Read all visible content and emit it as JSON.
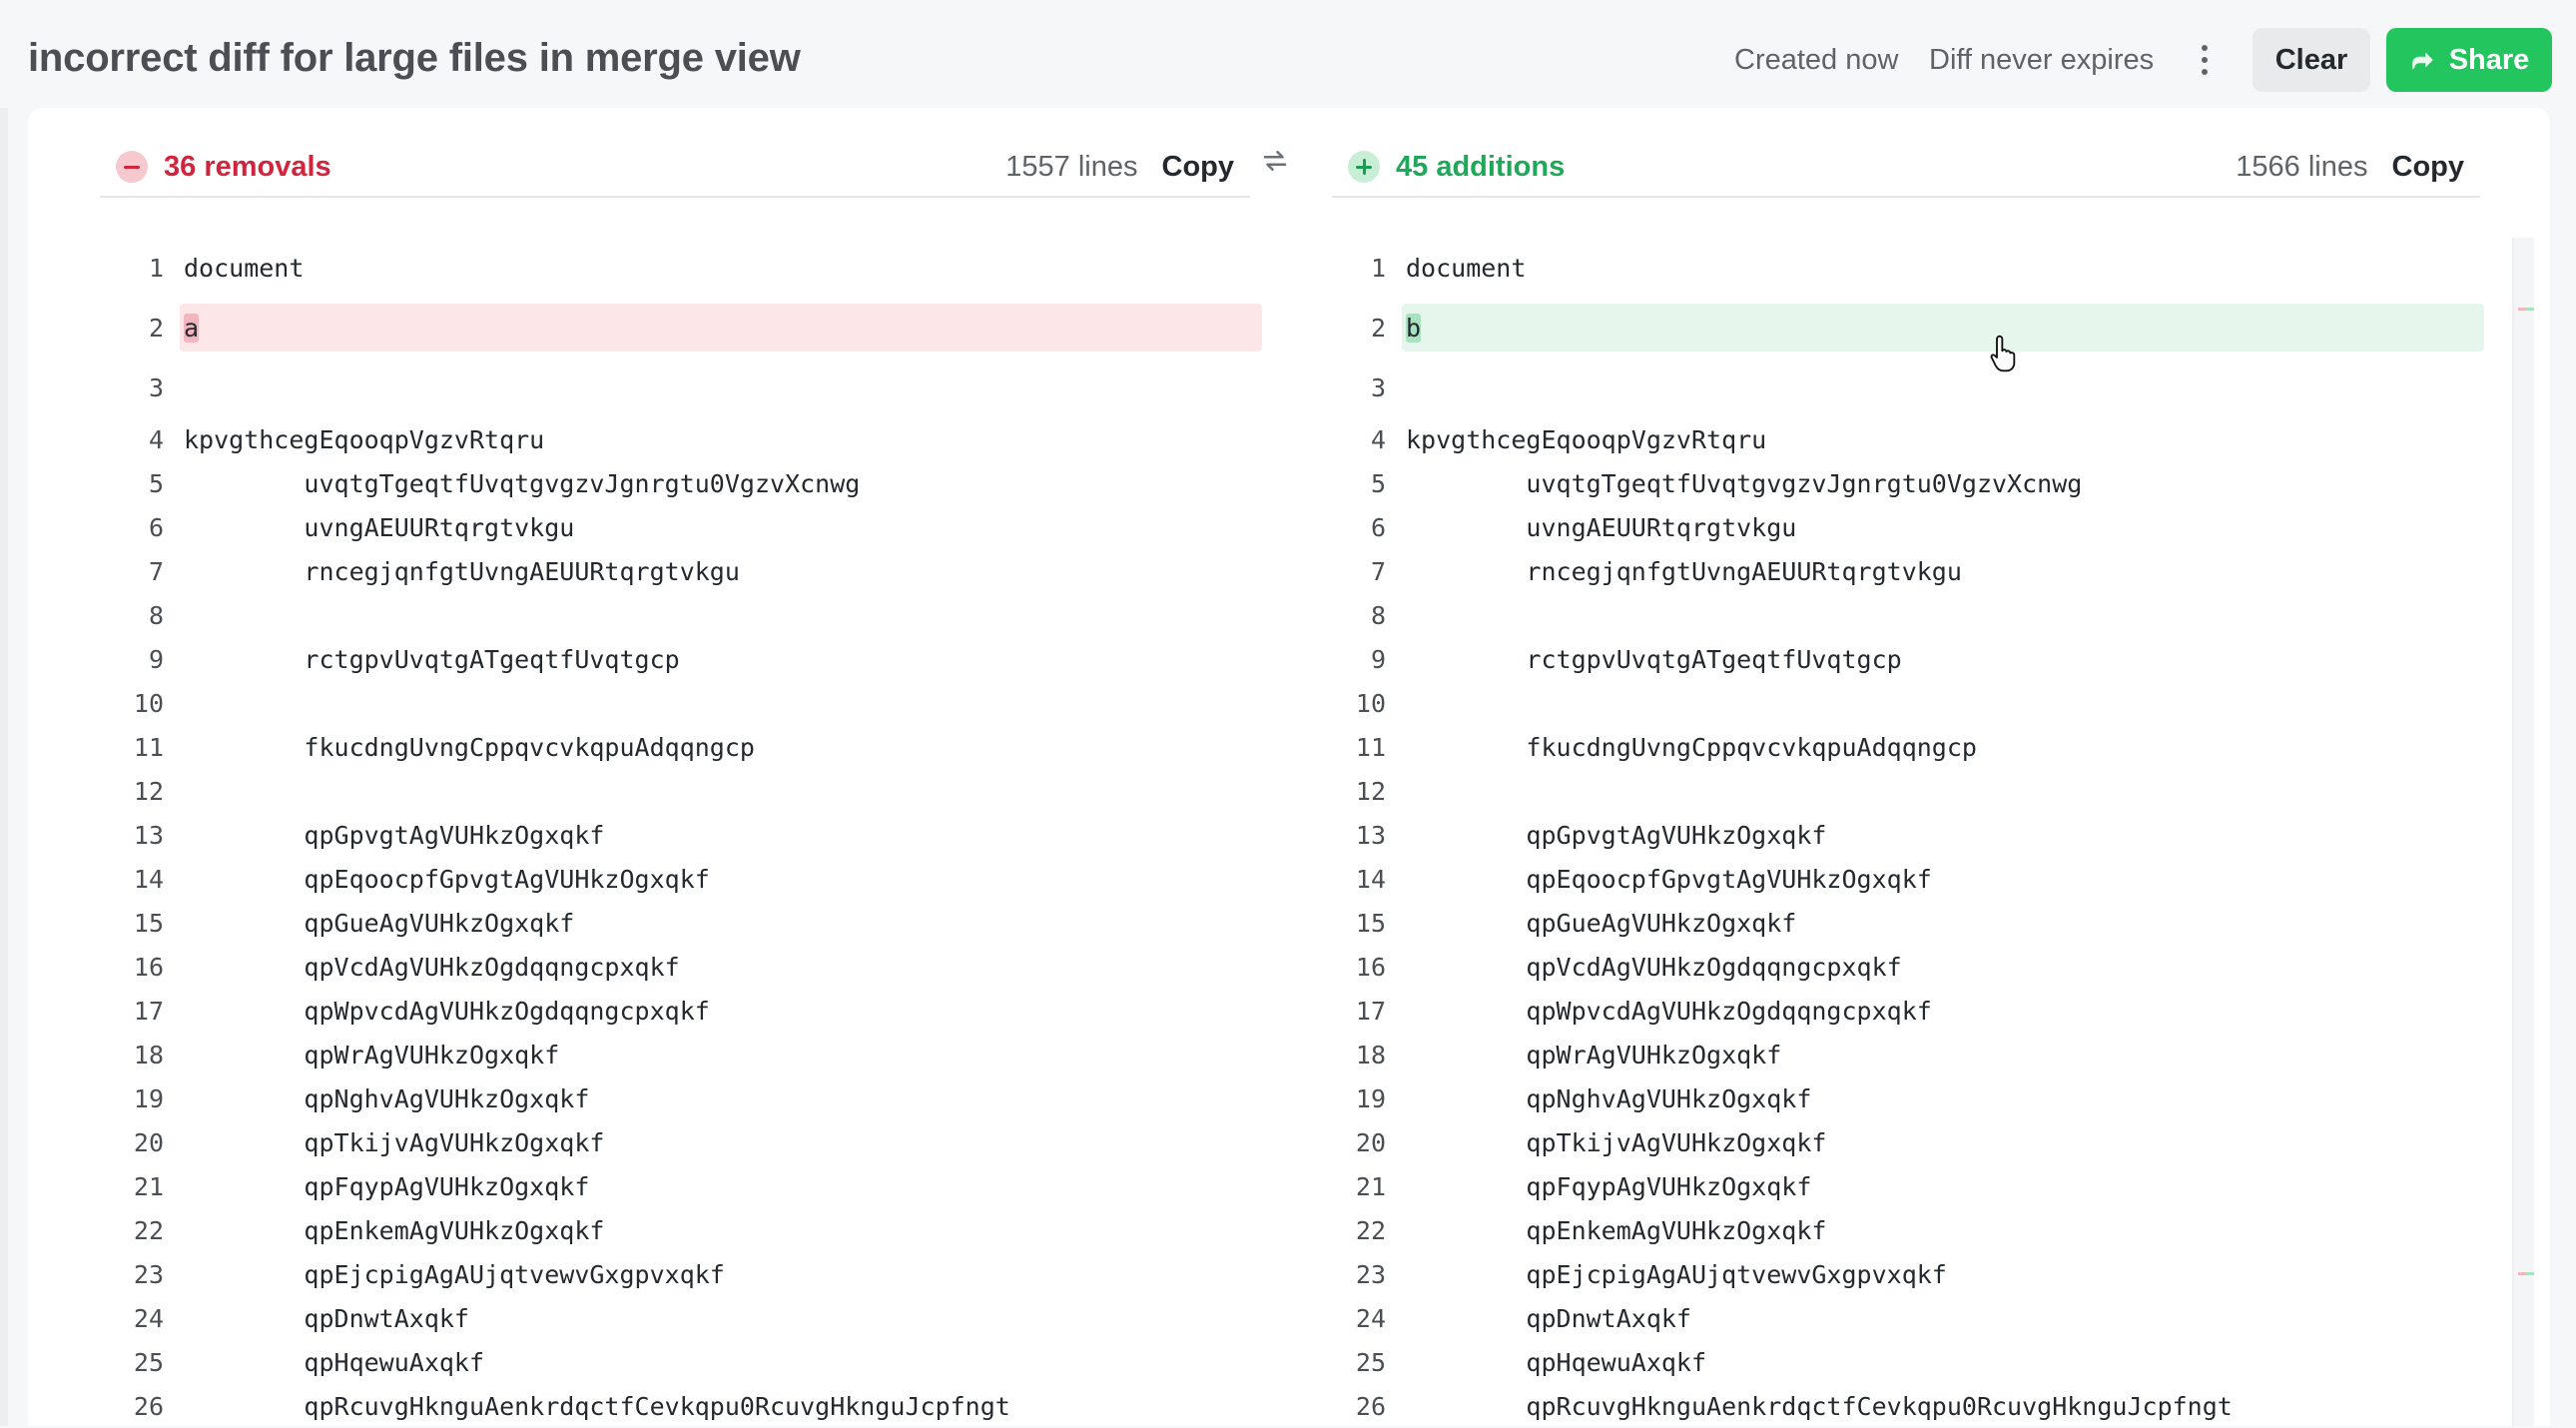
{
  "header": {
    "title": "incorrect diff for large files in merge view",
    "created": "Created now",
    "expires": "Diff never expires",
    "clear_label": "Clear",
    "share_label": "Share"
  },
  "left": {
    "summary": "36 removals",
    "lines": "1557 lines",
    "copy_label": "Copy"
  },
  "right": {
    "summary": "45 additions",
    "lines": "1566 lines",
    "copy_label": "Copy"
  },
  "colors": {
    "removal": "#d1243d",
    "addition": "#1fa85a",
    "share": "#22c55e"
  },
  "rows": [
    {
      "n": "1",
      "code": "document"
    },
    {
      "n": "2",
      "code": "",
      "changed": true,
      "left_char": "a",
      "right_char": "b"
    },
    {
      "n": "3",
      "code": ""
    },
    {
      "n": "4",
      "code": "kpvgthcegEqooqpVgzvRtqru"
    },
    {
      "n": "5",
      "code": "        uvqtgTgeqtfUvqtgvgzvJgnrgtu0VgzvXcnwg"
    },
    {
      "n": "6",
      "code": "        uvngAEUURtqrgtvkgu"
    },
    {
      "n": "7",
      "code": "        rncegjqnfgtUvngAEUURtqrgtvkgu"
    },
    {
      "n": "8",
      "code": ""
    },
    {
      "n": "9",
      "code": "        rctgpvUvqtgATgeqtfUvqtgcp"
    },
    {
      "n": "10",
      "code": ""
    },
    {
      "n": "11",
      "code": "        fkucdngUvngCppqvcvkqpuAdqqngcp"
    },
    {
      "n": "12",
      "code": ""
    },
    {
      "n": "13",
      "code": "        qpGpvgtAgVUHkzOgxqkf"
    },
    {
      "n": "14",
      "code": "        qpEqoocpfGpvgtAgVUHkzOgxqkf"
    },
    {
      "n": "15",
      "code": "        qpGueAgVUHkzOgxqkf"
    },
    {
      "n": "16",
      "code": "        qpVcdAgVUHkzOgdqqngcpxqkf"
    },
    {
      "n": "17",
      "code": "        qpWpvcdAgVUHkzOgdqqngcpxqkf"
    },
    {
      "n": "18",
      "code": "        qpWrAgVUHkzOgxqkf"
    },
    {
      "n": "19",
      "code": "        qpNghvAgVUHkzOgxqkf"
    },
    {
      "n": "20",
      "code": "        qpTkijvAgVUHkzOgxqkf"
    },
    {
      "n": "21",
      "code": "        qpFqypAgVUHkzOgxqkf"
    },
    {
      "n": "22",
      "code": "        qpEnkemAgVUHkzOgxqkf"
    },
    {
      "n": "23",
      "code": "        qpEjcpigAgAUjqtvewvGxgpvxqkf"
    },
    {
      "n": "24",
      "code": "        qpDnwtAxqkf"
    },
    {
      "n": "25",
      "code": "        qpHqewuAxqkf"
    },
    {
      "n": "26",
      "code": "        qpRcuvgHknguAenkrdqctfCevkqpu0RcuvgHknguJcpfngt"
    }
  ]
}
